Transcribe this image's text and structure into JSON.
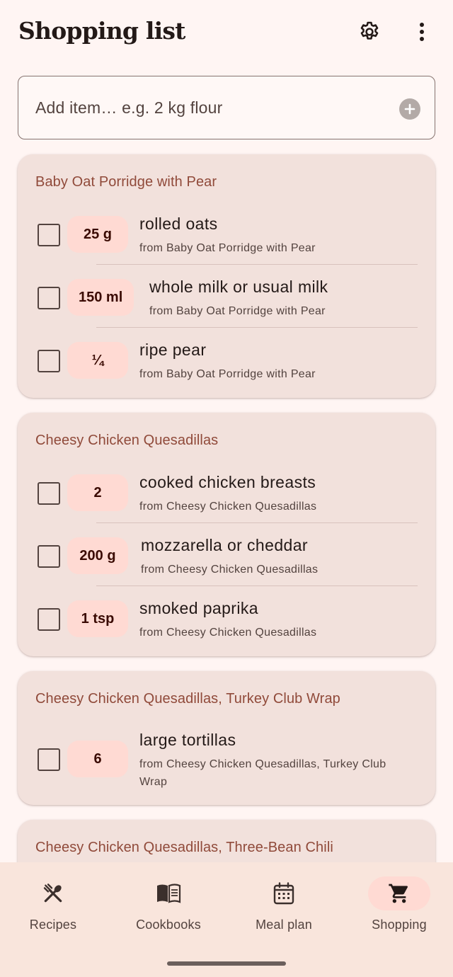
{
  "header": {
    "title": "Shopping list",
    "settings_icon": "gear-icon",
    "more_icon": "more-vert-icon"
  },
  "add_item": {
    "placeholder": "Add item… e.g. 2 kg flour",
    "icon": "add-circle-icon"
  },
  "groups": [
    {
      "title": "Baby Oat Porridge with Pear",
      "items": [
        {
          "qty": "25 g",
          "name": "rolled oats",
          "source": "from Baby Oat Porridge with Pear"
        },
        {
          "qty": "150 ml",
          "name": "whole milk or usual milk",
          "source": "from Baby Oat Porridge with Pear"
        },
        {
          "qty": "¼",
          "name": "ripe pear",
          "source": "from Baby Oat Porridge with Pear"
        }
      ]
    },
    {
      "title": "Cheesy Chicken Quesadillas",
      "items": [
        {
          "qty": "2",
          "name": "cooked chicken breasts",
          "source": "from Cheesy Chicken Quesadillas"
        },
        {
          "qty": "200 g",
          "name": "mozzarella or cheddar",
          "source": "from Cheesy Chicken Quesadillas"
        },
        {
          "qty": "1 tsp",
          "name": "smoked paprika",
          "source": "from Cheesy Chicken Quesadillas"
        }
      ]
    },
    {
      "title": "Cheesy Chicken Quesadillas, Turkey Club Wrap",
      "items": [
        {
          "qty": "6",
          "name": "large tortillas",
          "source_line1": "from Cheesy Chicken Quesadillas, Turkey Club",
          "source_line2": "Wrap"
        }
      ]
    },
    {
      "title": "Cheesy Chicken Quesadillas, Three-Bean Chili",
      "items": []
    }
  ],
  "nav": [
    {
      "label": "Recipes",
      "icon": "fork-spoon-icon",
      "active": false
    },
    {
      "label": "Cookbooks",
      "icon": "book-icon",
      "active": false
    },
    {
      "label": "Meal plan",
      "icon": "calendar-icon",
      "active": false
    },
    {
      "label": "Shopping",
      "icon": "cart-icon",
      "active": true
    }
  ],
  "colors": {
    "accent": "#904a3a",
    "chip": "#ffdad3",
    "card": "#f2e1dc",
    "background": "#fff5f3"
  }
}
